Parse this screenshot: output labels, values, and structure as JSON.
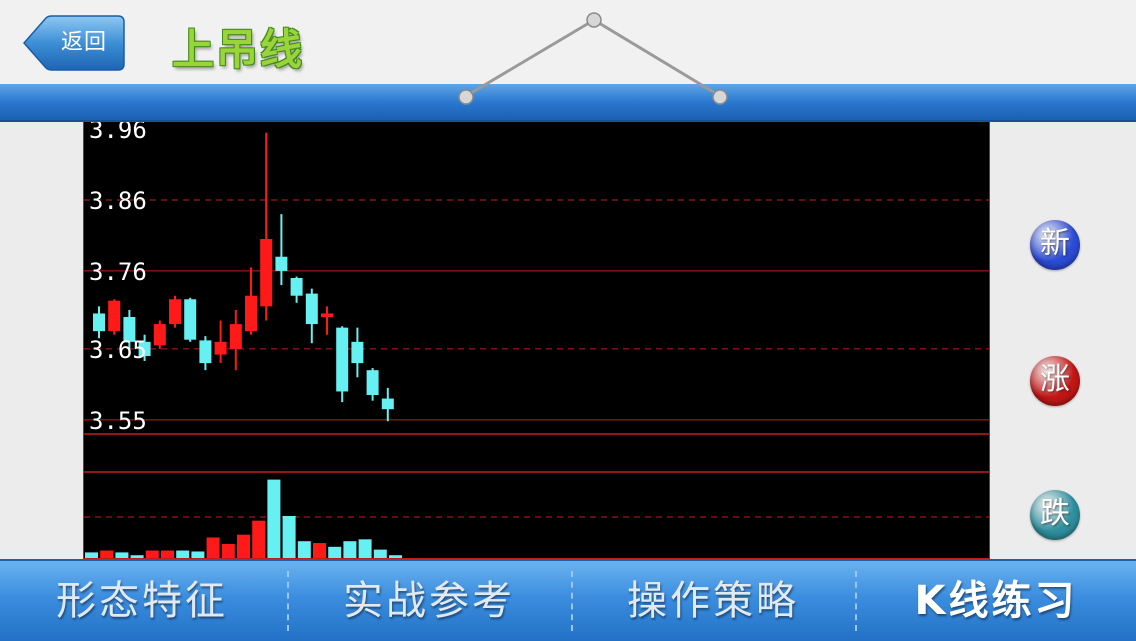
{
  "header": {
    "back_label": "返回",
    "title": "上吊线"
  },
  "side_buttons": [
    {
      "label": "新",
      "color": "#2c4bd6"
    },
    {
      "label": "涨",
      "color": "#c31616"
    },
    {
      "label": "跌",
      "color": "#2f8f9e"
    }
  ],
  "tabs": [
    {
      "label": "形态特征"
    },
    {
      "label": "实战参考"
    },
    {
      "label": "操作策略"
    },
    {
      "label": "K线练习",
      "active": true
    }
  ],
  "colors": {
    "up": "#ff1a1a",
    "down": "#66f0f2",
    "grid": "#c41e1e",
    "axis_text": "#ffffff",
    "accent_blue": "#2a78cf"
  },
  "chart_data": {
    "type": "candlestick",
    "title": "",
    "y_ticks": [
      "3.96",
      "3.86",
      "3.76",
      "3.65",
      "3.55"
    ],
    "ylim": [
      3.53,
      3.97
    ],
    "candles": [
      {
        "open": 3.7,
        "close": 3.675,
        "high": 3.71,
        "low": 3.665
      },
      {
        "open": 3.675,
        "close": 3.718,
        "high": 3.72,
        "low": 3.67
      },
      {
        "open": 3.695,
        "close": 3.66,
        "high": 3.705,
        "low": 3.65
      },
      {
        "open": 3.66,
        "close": 3.64,
        "high": 3.67,
        "low": 3.633
      },
      {
        "open": 3.655,
        "close": 3.685,
        "high": 3.69,
        "low": 3.65
      },
      {
        "open": 3.685,
        "close": 3.72,
        "high": 3.725,
        "low": 3.68
      },
      {
        "open": 3.72,
        "close": 3.663,
        "high": 3.722,
        "low": 3.66
      },
      {
        "open": 3.662,
        "close": 3.63,
        "high": 3.668,
        "low": 3.62
      },
      {
        "open": 3.642,
        "close": 3.66,
        "high": 3.69,
        "low": 3.63
      },
      {
        "open": 3.65,
        "close": 3.685,
        "high": 3.705,
        "low": 3.62
      },
      {
        "open": 3.675,
        "close": 3.725,
        "high": 3.765,
        "low": 3.67
      },
      {
        "open": 3.71,
        "close": 3.805,
        "high": 3.955,
        "low": 3.69
      },
      {
        "open": 3.78,
        "close": 3.76,
        "high": 3.84,
        "low": 3.74
      },
      {
        "open": 3.75,
        "close": 3.725,
        "high": 3.752,
        "low": 3.715
      },
      {
        "open": 3.728,
        "close": 3.685,
        "high": 3.735,
        "low": 3.658
      },
      {
        "open": 3.695,
        "close": 3.7,
        "high": 3.71,
        "low": 3.67
      },
      {
        "open": 3.68,
        "close": 3.59,
        "high": 3.682,
        "low": 3.575
      },
      {
        "open": 3.66,
        "close": 3.63,
        "high": 3.68,
        "low": 3.61
      },
      {
        "open": 3.62,
        "close": 3.585,
        "high": 3.623,
        "low": 3.577
      },
      {
        "open": 3.58,
        "close": 3.565,
        "high": 3.595,
        "low": 3.548
      }
    ],
    "volume": [
      6,
      8,
      6,
      3,
      8,
      8,
      8,
      7,
      22,
      15,
      25,
      40,
      84,
      45,
      18,
      16,
      12,
      18,
      20,
      9,
      3
    ]
  }
}
